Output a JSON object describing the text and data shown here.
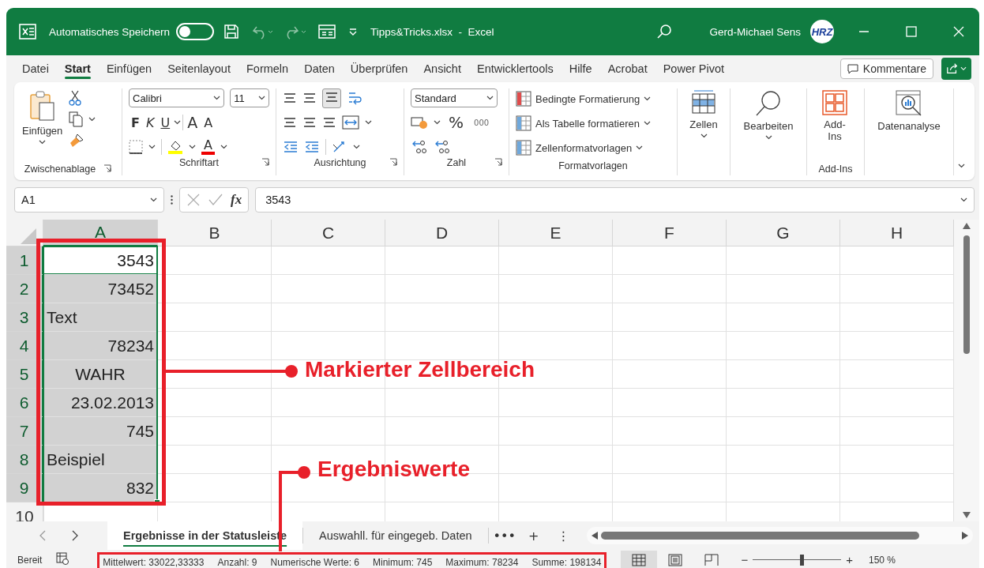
{
  "window": {
    "title": "Tipps&Tricks.xlsx  -  Excel",
    "autosave_label": "Automatisches Speichern",
    "autosave_on": false,
    "user": "Gerd-Michael Sens",
    "avatar": "HRZ"
  },
  "ribbon_tabs": [
    {
      "label": "Datei",
      "selected": false
    },
    {
      "label": "Start",
      "selected": true
    },
    {
      "label": "Einfügen",
      "selected": false
    },
    {
      "label": "Seitenlayout",
      "selected": false
    },
    {
      "label": "Formeln",
      "selected": false
    },
    {
      "label": "Daten",
      "selected": false
    },
    {
      "label": "Überprüfen",
      "selected": false
    },
    {
      "label": "Ansicht",
      "selected": false
    },
    {
      "label": "Entwicklertools",
      "selected": false
    },
    {
      "label": "Hilfe",
      "selected": false
    },
    {
      "label": "Acrobat",
      "selected": false
    },
    {
      "label": "Power Pivot",
      "selected": false
    }
  ],
  "comments_button": "Kommentare",
  "ribbon": {
    "clipboard": {
      "paste": "Einfügen",
      "caption": "Zwischenablage"
    },
    "font": {
      "name": "Calibri",
      "size": "11",
      "styles": [
        "F",
        "K",
        "U"
      ],
      "grow": "A",
      "shrink": "A",
      "color_button": "A",
      "caption": "Schriftart"
    },
    "alignment": {
      "caption": "Ausrichtung"
    },
    "number": {
      "format": "Standard",
      "percent": "%",
      "thousands": "000",
      "caption": "Zahl"
    },
    "styles": {
      "items": [
        "Bedingte Formatierung",
        "Als Tabelle formatieren",
        "Zellenformatvorlagen"
      ],
      "caption": "Formatvorlagen"
    },
    "cells": "Zellen",
    "editing": "Bearbeiten",
    "addins": {
      "button": "Add-Ins",
      "caption": "Add-Ins"
    },
    "analysis": "Datenanalyse"
  },
  "formula_bar": {
    "cell": "A1",
    "fx": "fx",
    "value": "3543"
  },
  "grid": {
    "columns": [
      {
        "label": "A",
        "selected": true
      },
      {
        "label": "B",
        "selected": false
      },
      {
        "label": "C",
        "selected": false
      },
      {
        "label": "D",
        "selected": false
      },
      {
        "label": "E",
        "selected": false
      },
      {
        "label": "F",
        "selected": false
      },
      {
        "label": "G",
        "selected": false
      },
      {
        "label": "H",
        "selected": false
      }
    ],
    "rows": [
      {
        "label": "1",
        "selected": true,
        "active": true,
        "value": "3543",
        "kind": "number"
      },
      {
        "label": "2",
        "selected": true,
        "active": false,
        "value": "73452",
        "kind": "number"
      },
      {
        "label": "3",
        "selected": true,
        "active": false,
        "value": "Text",
        "kind": "text"
      },
      {
        "label": "4",
        "selected": true,
        "active": false,
        "value": "78234",
        "kind": "number"
      },
      {
        "label": "5",
        "selected": true,
        "active": false,
        "value": "WAHR",
        "kind": "boolean"
      },
      {
        "label": "6",
        "selected": true,
        "active": false,
        "value": "23.02.2013",
        "kind": "number"
      },
      {
        "label": "7",
        "selected": true,
        "active": false,
        "value": "745",
        "kind": "number"
      },
      {
        "label": "8",
        "selected": true,
        "active": false,
        "value": "Beispiel",
        "kind": "text"
      },
      {
        "label": "9",
        "selected": true,
        "active": false,
        "value": "832",
        "kind": "number"
      },
      {
        "label": "10",
        "selected": false
      }
    ]
  },
  "sheet_tabs": [
    {
      "label": "Ergebnisse in der Statusleiste",
      "selected": true
    },
    {
      "label": "Auswahll. für eingegeb. Daten",
      "selected": false
    }
  ],
  "sheet_actions": [
    "•••",
    "+",
    "⋮"
  ],
  "status_bar": {
    "mode": "Bereit",
    "stats": [
      "Mittelwert: 33022,33333",
      "Anzahl: 9",
      "Numerische Werte: 6",
      "Minimum: 745",
      "Maximum: 78234",
      "Summe: 198134"
    ],
    "views": [
      {
        "kind": "normal",
        "selected": true
      },
      {
        "kind": "layout",
        "selected": false
      },
      {
        "kind": "pagebreak",
        "selected": false
      }
    ],
    "zoom_out": "−",
    "zoom_in": "+",
    "zoom_slider": {
      "level": 0.55
    },
    "zoom": "150 %"
  },
  "annotations": [
    {
      "text": "Markierter Zellbereich"
    },
    {
      "text": "Ergebniswerte"
    }
  ]
}
